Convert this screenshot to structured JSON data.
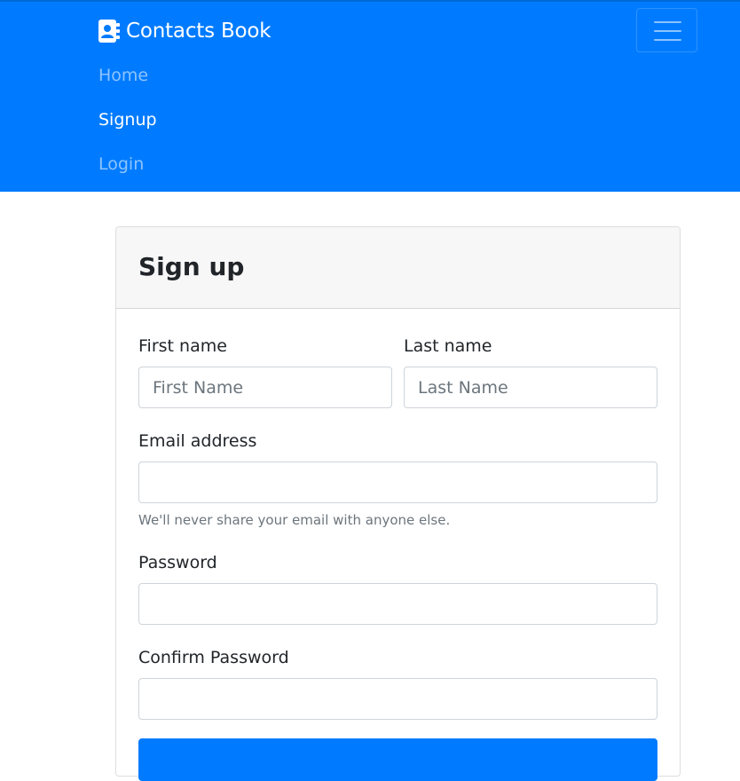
{
  "navbar": {
    "brand": "Contacts Book",
    "brand_icon": "address-book-icon",
    "toggler_icon": "hamburger-menu-icon",
    "links": [
      {
        "label": "Home",
        "active": false
      },
      {
        "label": "Signup",
        "active": true
      },
      {
        "label": "Login",
        "active": false
      }
    ],
    "background": "#007bff"
  },
  "form": {
    "title": "Sign up",
    "first_name": {
      "label": "First name",
      "placeholder": "First Name",
      "value": ""
    },
    "last_name": {
      "label": "Last name",
      "placeholder": "Last Name",
      "value": ""
    },
    "email": {
      "label": "Email address",
      "placeholder": "",
      "value": "",
      "help": "We'll never share your email with anyone else."
    },
    "password": {
      "label": "Password",
      "placeholder": "",
      "value": ""
    },
    "confirm_password": {
      "label": "Confirm Password",
      "placeholder": "",
      "value": ""
    }
  }
}
